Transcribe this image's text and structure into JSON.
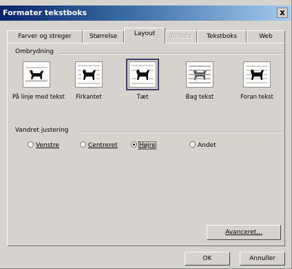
{
  "window": {
    "title": "Formater tekstboks",
    "close_label": "x"
  },
  "tabs": [
    {
      "label": "Farver og streger"
    },
    {
      "label": "Størrelse"
    },
    {
      "label": "Layout"
    },
    {
      "label": "Billede"
    },
    {
      "label": "Tekstboks"
    },
    {
      "label": "Web"
    }
  ],
  "wrapping": {
    "heading": "Ombrydning",
    "options": [
      {
        "label": "På linje med tekst",
        "icon": "wrap-inline-icon",
        "selected": false
      },
      {
        "label": "Firkantet",
        "icon": "wrap-square-icon",
        "selected": false
      },
      {
        "label": "Tæt",
        "icon": "wrap-tight-icon",
        "selected": true
      },
      {
        "label": "Bag tekst",
        "icon": "wrap-behind-icon",
        "selected": false
      },
      {
        "label": "Foran tekst",
        "icon": "wrap-front-icon",
        "selected": false
      }
    ]
  },
  "alignment": {
    "heading": "Vandret justering",
    "options": [
      {
        "label": "Venstre",
        "selected": false
      },
      {
        "label": "Centreret",
        "selected": false
      },
      {
        "label": "Højre",
        "selected": true
      },
      {
        "label": "Andet",
        "selected": false
      }
    ]
  },
  "buttons": {
    "advanced": "Avanceret...",
    "ok": "OK",
    "cancel": "Annuller"
  }
}
